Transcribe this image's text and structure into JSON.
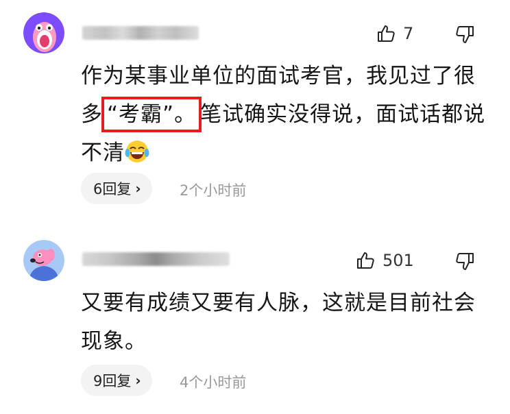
{
  "comments": [
    {
      "likes": "7",
      "text_before": "作为某事业单位的面试考官，我见过了很多",
      "text_highlight": "“考霸”。",
      "text_after": "笔试确实没得说，面试话都说不清",
      "emoji": "laughing-tears-emoji",
      "reply_count": "6回复",
      "time": "2个小时前"
    },
    {
      "likes": "501",
      "text": "又要有成绩又要有人脉，这就是目前社会现象。",
      "reply_count": "9回复",
      "time": "4个小时前"
    }
  ],
  "colors": {
    "highlight_border": "#e41d1d",
    "avatar1_bg": "#7c4dff",
    "avatar2_bg": "#5a8cf0",
    "reply_bg": "#f3f3f3",
    "muted_text": "#999999"
  },
  "icons": [
    "thumb-up-icon",
    "thumb-down-icon",
    "chevron-right-icon"
  ]
}
